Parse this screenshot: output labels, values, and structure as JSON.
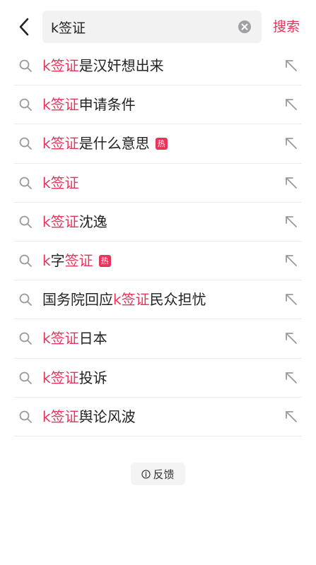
{
  "header": {
    "query": "k签证",
    "search_label": "搜索"
  },
  "suggestions": [
    {
      "parts": [
        {
          "text": "k签证",
          "hl": true
        },
        {
          "text": "是汉奸想出来",
          "hl": false
        }
      ],
      "hot": false
    },
    {
      "parts": [
        {
          "text": "k签证",
          "hl": true
        },
        {
          "text": "申请条件",
          "hl": false
        }
      ],
      "hot": false
    },
    {
      "parts": [
        {
          "text": "k签证",
          "hl": true
        },
        {
          "text": "是什么意思",
          "hl": false
        }
      ],
      "hot": true
    },
    {
      "parts": [
        {
          "text": "k签证",
          "hl": true
        }
      ],
      "hot": false
    },
    {
      "parts": [
        {
          "text": "k签证",
          "hl": true
        },
        {
          "text": "沈逸",
          "hl": false
        }
      ],
      "hot": false
    },
    {
      "parts": [
        {
          "text": "k",
          "hl": true
        },
        {
          "text": "字",
          "hl": false
        },
        {
          "text": "签证",
          "hl": true
        }
      ],
      "hot": true
    },
    {
      "parts": [
        {
          "text": "国务院回应",
          "hl": false
        },
        {
          "text": "k签证",
          "hl": true
        },
        {
          "text": "民众担忧",
          "hl": false
        }
      ],
      "hot": false
    },
    {
      "parts": [
        {
          "text": "k签证",
          "hl": true
        },
        {
          "text": "日本",
          "hl": false
        }
      ],
      "hot": false
    },
    {
      "parts": [
        {
          "text": "k签证",
          "hl": true
        },
        {
          "text": "投诉",
          "hl": false
        }
      ],
      "hot": false
    },
    {
      "parts": [
        {
          "text": "k签证",
          "hl": true
        },
        {
          "text": "舆论风波",
          "hl": false
        }
      ],
      "hot": false
    }
  ],
  "hot_badge_label": "热",
  "feedback": {
    "label": "反馈",
    "icon": "info-icon"
  },
  "colors": {
    "accent": "#e8345a",
    "text": "#222222",
    "icon_gray": "#9a9a9a",
    "divider": "#ebebeb",
    "search_bg": "#f2f2f3"
  },
  "icons": {
    "back": "back-arrow-icon",
    "clear": "clear-icon",
    "search": "search-icon",
    "fill": "arrow-up-left-icon"
  }
}
